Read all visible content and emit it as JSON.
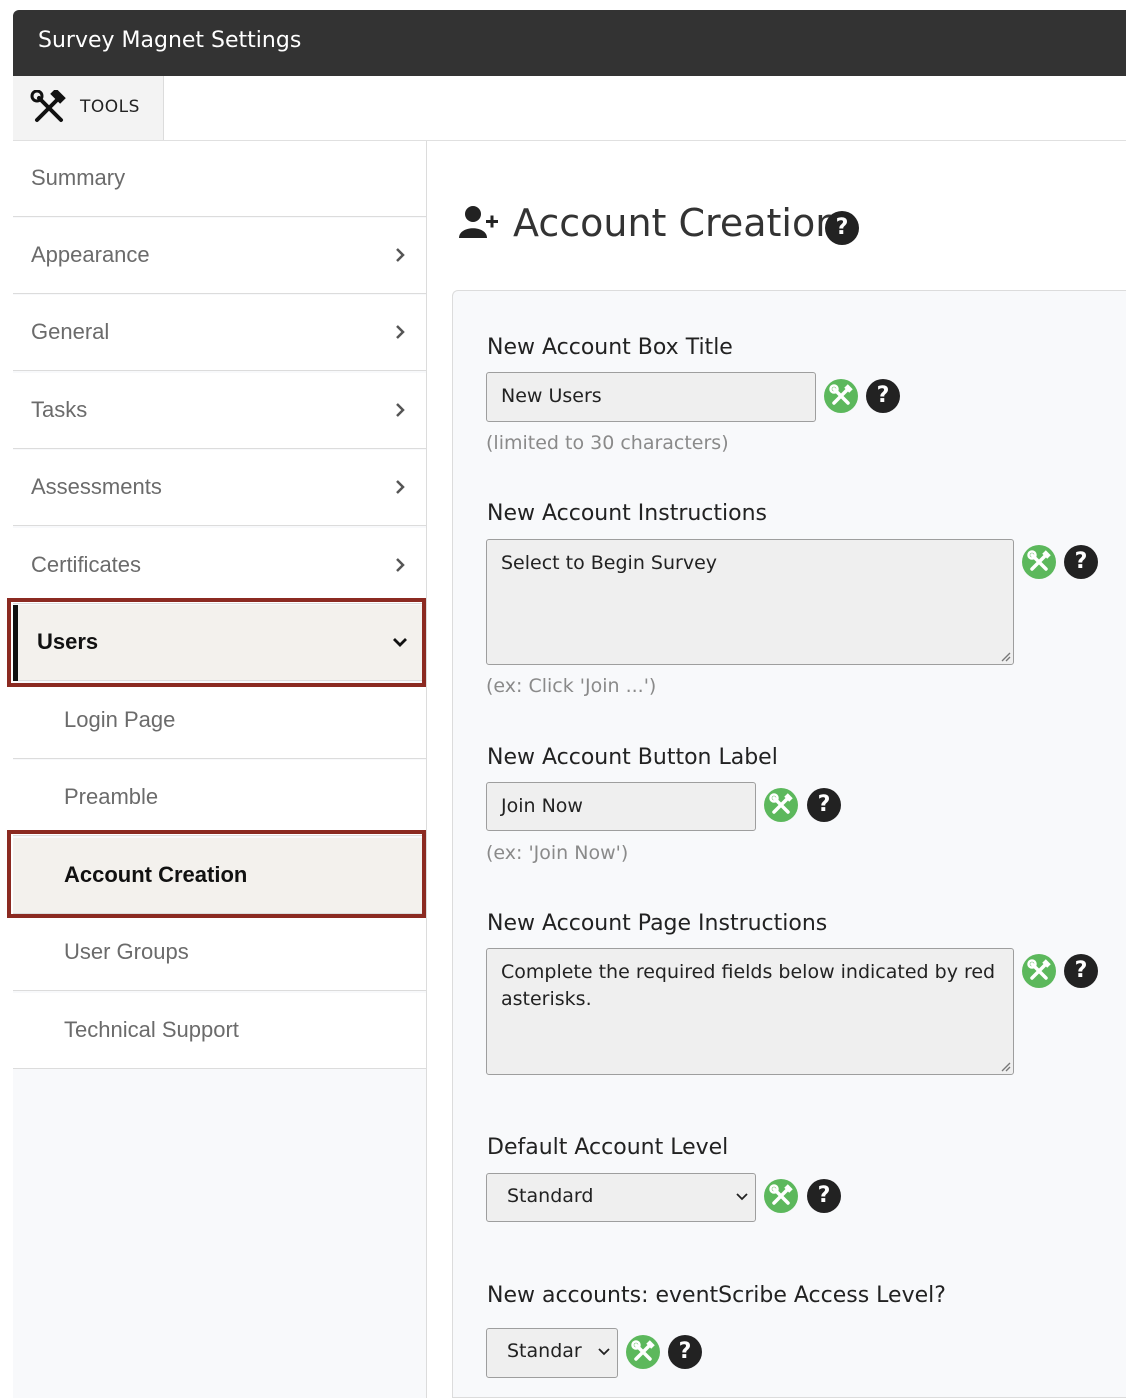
{
  "window": {
    "title": "Survey Magnet Settings"
  },
  "toolbar": {
    "tools_label": "TOOLS"
  },
  "sidebar": {
    "summary": "Summary",
    "appearance": "Appearance",
    "general": "General",
    "tasks": "Tasks",
    "assessments": "Assessments",
    "certificates": "Certificates",
    "users": "Users",
    "login_page": "Login Page",
    "preamble": "Preamble",
    "account_creation": "Account Creation",
    "user_groups": "User Groups",
    "technical_support": "Technical Support"
  },
  "page": {
    "title": "Account Creation",
    "help_glyph": "?"
  },
  "fields": {
    "box_title": {
      "label": "New Account Box Title",
      "value": "New Users",
      "hint": "(limited to 30 characters)"
    },
    "instructions": {
      "label": "New Account Instructions",
      "value": "Select to Begin Survey",
      "hint": "(ex: Click 'Join ...')"
    },
    "button_label": {
      "label": "New Account Button Label",
      "value": "Join Now",
      "hint": "(ex: 'Join Now')"
    },
    "page_instructions": {
      "label": "New Account Page Instructions",
      "value": "Complete the required fields below indicated by red asterisks."
    },
    "default_level": {
      "label": "Default Account Level",
      "selected": "Standard"
    },
    "eventscribe_level": {
      "label": "New accounts: eventScribe Access Level?",
      "selected": "Standar"
    }
  },
  "colors": {
    "header_bg": "#333333",
    "highlight_border": "#8b2a21",
    "settings_icon_bg": "#5cb85c",
    "help_icon_bg": "#222222"
  },
  "icons": {
    "tools": "hammer-wrench-icon",
    "account": "user-plus-icon",
    "settings": "wrench-screwdriver-icon",
    "help": "question-icon"
  }
}
